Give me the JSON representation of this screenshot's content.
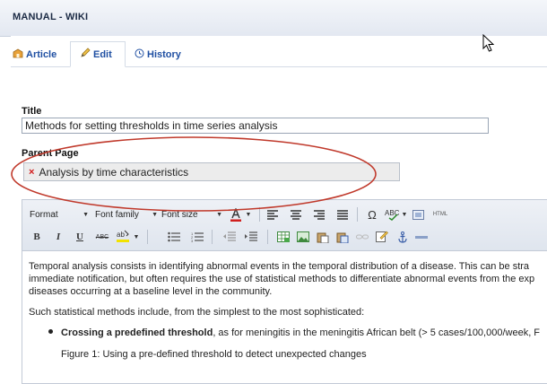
{
  "header": {
    "title": "MANUAL - WIKI"
  },
  "tabs": [
    {
      "label": "Article",
      "icon": "article-icon",
      "active": false
    },
    {
      "label": "Edit",
      "icon": "pencil-icon",
      "active": true
    },
    {
      "label": "History",
      "icon": "history-icon",
      "active": false
    }
  ],
  "form": {
    "title_label": "Title",
    "title_value": "Methods for setting thresholds in time series analysis",
    "parent_label": "Parent Page",
    "parent_value": "Analysis by time characteristics",
    "remove_symbol": "×"
  },
  "toolbar": {
    "format": "Format",
    "font_family": "Font family",
    "font_size": "Font size",
    "html_label": "HTML",
    "bold": "B",
    "italic": "I",
    "underline": "U",
    "strike": "ABC",
    "omega": "Ω"
  },
  "content": {
    "p1_line1": "Temporal analysis consists in identifying abnormal events in the temporal distribution of a disease. This can be stra",
    "p1_line2": "immediate notification, but often requires the use of statistical methods to differentiate abnormal events from the exp",
    "p1_line3": "diseases occurring at a baseline level in the community.",
    "p2": "Such statistical methods include, from the simplest to the most sophisticated:",
    "bullet_bold": "Crossing a predefined threshold",
    "bullet_rest": ", as for meningitis in the meningitis African belt (> 5 cases/100,000/week, F",
    "figure_caption": "Figure 1: Using a pre-defined threshold to detect unexpected changes"
  },
  "colors": {
    "link_blue": "#1f4fa2",
    "ellipse_red": "#c0392b",
    "remove_red": "#d21a1a"
  }
}
